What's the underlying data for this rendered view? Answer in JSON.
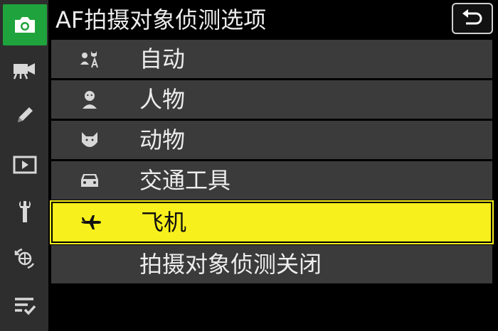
{
  "header": {
    "title": "AF拍摄对象侦测选项"
  },
  "sidebar": {
    "items": [
      {
        "name": "camera-icon",
        "active": true
      },
      {
        "name": "movie-icon",
        "active": false
      },
      {
        "name": "pencil-icon",
        "active": false
      },
      {
        "name": "playback-icon",
        "active": false
      },
      {
        "name": "wrench-icon",
        "active": false
      },
      {
        "name": "network-icon",
        "active": false
      },
      {
        "name": "my-menu-icon",
        "active": false
      }
    ]
  },
  "menu": {
    "options": [
      {
        "label": "自动",
        "icon": "auto-subject-icon",
        "selected": false
      },
      {
        "label": "人物",
        "icon": "person-icon",
        "selected": false
      },
      {
        "label": "动物",
        "icon": "animal-icon",
        "selected": false
      },
      {
        "label": "交通工具",
        "icon": "vehicle-icon",
        "selected": false
      },
      {
        "label": "飞机",
        "icon": "airplane-icon",
        "selected": true
      },
      {
        "label": "拍摄对象侦测关闭",
        "icon": "",
        "selected": false
      }
    ]
  },
  "colors": {
    "active_tab": "#1fa33c",
    "selection": "#f7f01c",
    "row": "#3b3b3b",
    "sidebar": "#2e2e2e"
  }
}
